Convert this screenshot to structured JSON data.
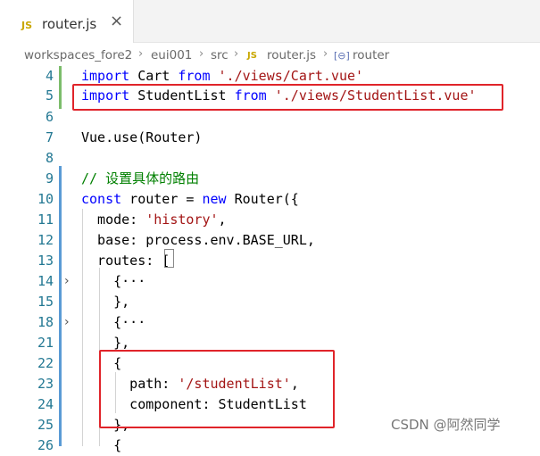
{
  "tab": {
    "icon": "JS",
    "title": "router.js",
    "close": "×"
  },
  "breadcrumb": {
    "items": [
      "workspaces_fore2",
      "eui001",
      "src",
      "router.js",
      "router"
    ],
    "file_icon": "JS",
    "symbol_icon": "[⊖]",
    "separator": "›"
  },
  "code_lines": [
    {
      "num": "4",
      "parts": [
        {
          "t": "import",
          "c": "kw"
        },
        {
          "t": " Cart "
        },
        {
          "t": "from",
          "c": "kw"
        },
        {
          "t": " "
        },
        {
          "t": "'./views/Cart.vue'",
          "c": "str"
        }
      ]
    },
    {
      "num": "5",
      "parts": [
        {
          "t": "import",
          "c": "kw"
        },
        {
          "t": " StudentList "
        },
        {
          "t": "from",
          "c": "kw"
        },
        {
          "t": " "
        },
        {
          "t": "'./views/StudentList.vue'",
          "c": "str"
        }
      ]
    },
    {
      "num": "6",
      "parts": []
    },
    {
      "num": "7",
      "parts": [
        {
          "t": "Vue.use(Router)"
        }
      ]
    },
    {
      "num": "8",
      "parts": []
    },
    {
      "num": "9",
      "parts": [
        {
          "t": "// 设置具体的路由",
          "c": "com"
        }
      ]
    },
    {
      "num": "10",
      "parts": [
        {
          "t": "const",
          "c": "kw"
        },
        {
          "t": " router = "
        },
        {
          "t": "new",
          "c": "kw"
        },
        {
          "t": " Router({"
        }
      ]
    },
    {
      "num": "11",
      "parts": [
        {
          "t": "  mode: "
        },
        {
          "t": "'history'",
          "c": "str"
        },
        {
          "t": ","
        }
      ]
    },
    {
      "num": "12",
      "parts": [
        {
          "t": "  base: process.env.BASE_URL,"
        }
      ]
    },
    {
      "num": "13",
      "parts": [
        {
          "t": "  routes: ["
        }
      ]
    },
    {
      "num": "14",
      "parts": [
        {
          "t": "    {···"
        }
      ]
    },
    {
      "num": "15",
      "parts": [
        {
          "t": "    },"
        }
      ]
    },
    {
      "num": "18",
      "parts": [
        {
          "t": "    {···"
        }
      ]
    },
    {
      "num": "21",
      "parts": [
        {
          "t": "    },"
        }
      ]
    },
    {
      "num": "22",
      "parts": [
        {
          "t": "    {"
        }
      ]
    },
    {
      "num": "23",
      "parts": [
        {
          "t": "      path: "
        },
        {
          "t": "'/studentList'",
          "c": "str"
        },
        {
          "t": ","
        }
      ]
    },
    {
      "num": "24",
      "parts": [
        {
          "t": "      component: StudentList"
        }
      ]
    },
    {
      "num": "25",
      "parts": [
        {
          "t": "    },"
        }
      ]
    },
    {
      "num": "26",
      "parts": [
        {
          "t": "    {"
        }
      ]
    }
  ],
  "folds": {
    "14": "›",
    "18": "›"
  },
  "watermark": "CSDN @阿然同学",
  "colors": {
    "keyword": "#0000ff",
    "string": "#a31515",
    "comment": "#008000",
    "line_number": "#237893",
    "highlight_box": "#e0242a"
  }
}
